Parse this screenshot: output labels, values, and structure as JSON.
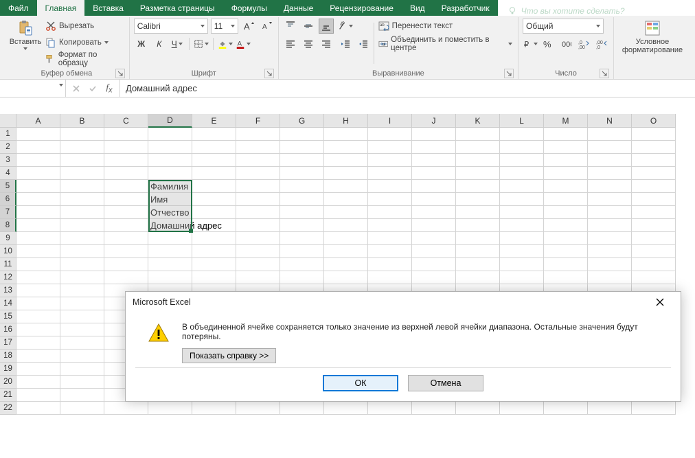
{
  "tabs": {
    "file": "Файл",
    "home": "Главная",
    "insert": "Вставка",
    "pagelayout": "Разметка страницы",
    "formulas": "Формулы",
    "data": "Данные",
    "review": "Рецензирование",
    "view": "Вид",
    "developer": "Разработчик",
    "tellme": "Что вы хотите сделать?"
  },
  "ribbon": {
    "clipboard": {
      "paste": "Вставить",
      "cut": "Вырезать",
      "copy": "Копировать",
      "formatpainter": "Формат по образцу",
      "label": "Буфер обмена"
    },
    "font": {
      "name": "Calibri",
      "size": "11",
      "bold": "Ж",
      "italic": "К",
      "underline": "Ч",
      "label": "Шрифт"
    },
    "alignment": {
      "wrap": "Перенести текст",
      "merge": "Объединить и поместить в центре",
      "label": "Выравнивание"
    },
    "number": {
      "format": "Общий",
      "label": "Число"
    },
    "cond": {
      "label1": "Условное",
      "label2": "форматирование"
    }
  },
  "formula_bar": {
    "value": "Домашний адрес"
  },
  "columns": [
    "A",
    "B",
    "C",
    "D",
    "E",
    "F",
    "G",
    "H",
    "I",
    "J",
    "K",
    "L",
    "M",
    "N",
    "O"
  ],
  "cells": {
    "D5": "Фамилия",
    "D6": "Имя",
    "D7": "Отчество",
    "D8": "Домашний адрес"
  },
  "dialog": {
    "title": "Microsoft Excel",
    "message": "В объединенной ячейке сохраняется только значение из верхней левой ячейки диапазона. Остальные значения будут потеряны.",
    "help": "Показать справку >>",
    "ok": "ОК",
    "cancel": "Отмена"
  }
}
